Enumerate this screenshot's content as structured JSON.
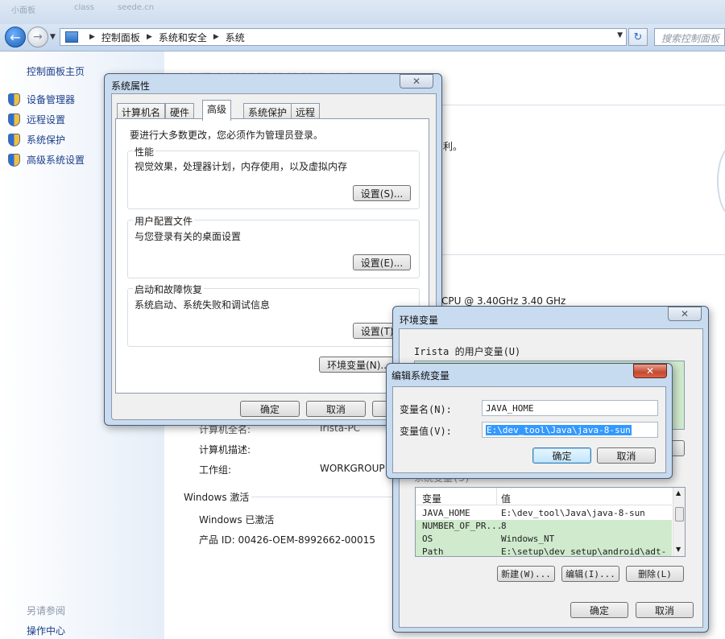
{
  "topstrip": {
    "items": [
      "小面板",
      "class",
      "seede.cn"
    ]
  },
  "address_bar": {
    "crumbs": [
      "控制面板",
      "系统和安全",
      "系统"
    ],
    "search_placeholder": "搜索控制面板"
  },
  "sidebar": {
    "home": "控制面板主页",
    "links": [
      "设备管理器",
      "远程设置",
      "系统保护",
      "高级系统设置"
    ],
    "see_also": "另请参阅",
    "action_center": "操作中心"
  },
  "main": {
    "title": "查看有关计算机的基本信息",
    "partial_text_1": "利。",
    "cpu_text": "CPU @ 3.40GHz   3.40 GHz",
    "computer_name_label": "计算机全名:",
    "computer_name_value": "Irista-PC",
    "computer_desc_label": "计算机描述:",
    "workgroup_label": "工作组:",
    "workgroup_value": "WORKGROUP",
    "activation_heading": "Windows 激活",
    "activation_status": "Windows 已激活",
    "product_id": "产品 ID: 00426-OEM-8992662-00015"
  },
  "sysprops": {
    "title": "系统属性",
    "tabs": [
      "计算机名",
      "硬件",
      "高级",
      "系统保护",
      "远程"
    ],
    "admin_note": "要进行大多数更改，您必须作为管理员登录。",
    "perf_title": "性能",
    "perf_desc": "视觉效果，处理器计划，内存使用，以及虚拟内存",
    "perf_button": "设置(S)...",
    "profile_title": "用户配置文件",
    "profile_desc": "与您登录有关的桌面设置",
    "profile_button": "设置(E)...",
    "startup_title": "启动和故障恢复",
    "startup_desc": "系统启动、系统失败和调试信息",
    "startup_button": "设置(T)...",
    "env_button": "环境变量(N)...",
    "ok": "确定",
    "cancel": "取消"
  },
  "envvars": {
    "title": "环境变量",
    "user_vars_label": "Irista 的用户变量(U)",
    "sys_vars_label": "系统变量(S)",
    "col_var": "变量",
    "col_val": "值",
    "rows": [
      {
        "name": "JAVA_HOME",
        "value": "E:\\dev_tool\\Java\\java-8-sun"
      },
      {
        "name": "NUMBER_OF_PR...",
        "value": "8"
      },
      {
        "name": "OS",
        "value": "Windows_NT"
      },
      {
        "name": "Path",
        "value": "E:\\setup\\dev_setup\\android\\adt-"
      }
    ],
    "new_btn": "新建(W)...",
    "edit_btn": "编辑(I)...",
    "delete_btn": "删除(L)",
    "ok": "确定",
    "cancel": "取消"
  },
  "editvar": {
    "title": "编辑系统变量",
    "name_label": "变量名(N):",
    "name_value": "JAVA_HOME",
    "value_label": "变量值(V):",
    "value_value": "E:\\dev_tool\\Java\\java-8-sun",
    "ok": "确定",
    "cancel": "取消"
  },
  "colors": {
    "accent": "#1b3e8a",
    "selection": "#cfeacd"
  }
}
